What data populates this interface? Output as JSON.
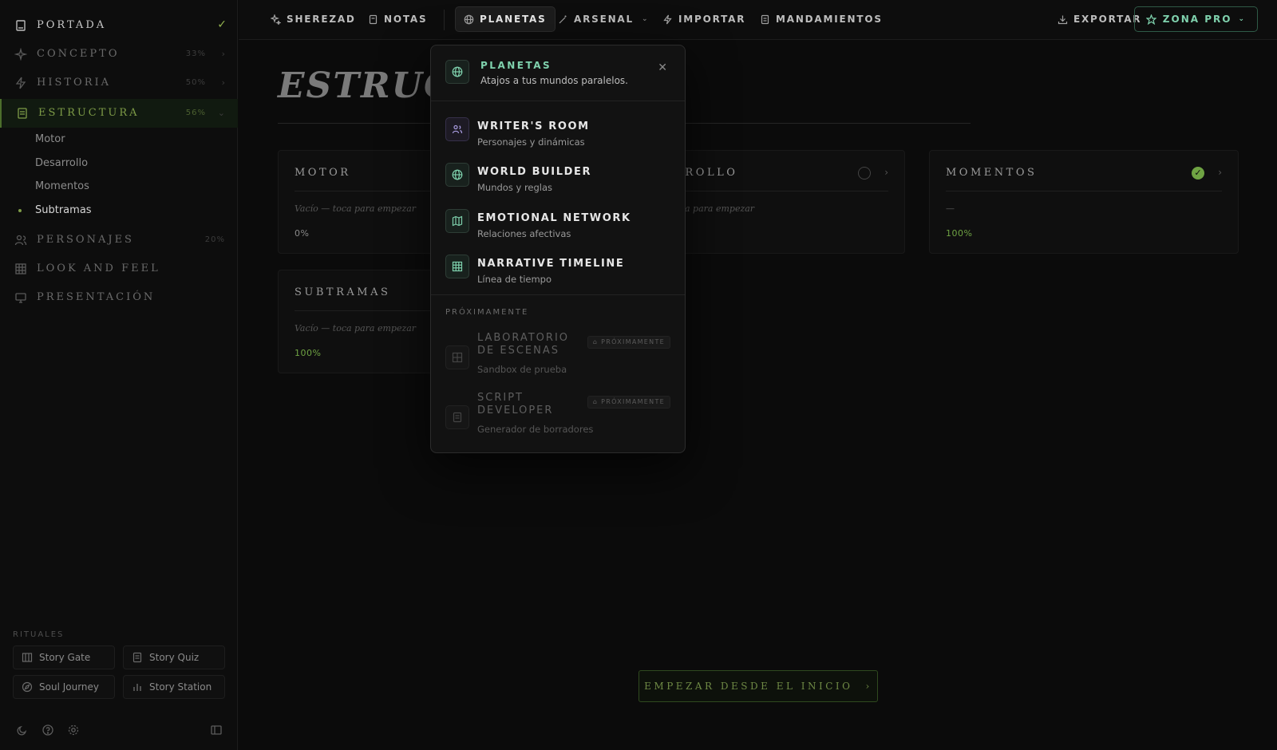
{
  "sidebar": {
    "portada": {
      "label": "PORTADA"
    },
    "items": [
      {
        "label": "CONCEPTO",
        "pct": "33%"
      },
      {
        "label": "HISTORIA",
        "pct": "50%"
      },
      {
        "label": "ESTRUCTURA",
        "pct": "56%"
      }
    ],
    "sub_items": [
      "Motor",
      "Desarrollo",
      "Momentos",
      "Subtramas"
    ],
    "items_after": [
      {
        "label": "PERSONAJES",
        "pct": "20%"
      },
      {
        "label": "LOOK AND FEEL"
      },
      {
        "label": "PRESENTACIÓN"
      }
    ],
    "rituales_title": "RITUALES",
    "rituales": [
      "Story Gate",
      "Story Quiz",
      "Soul Journey",
      "Story Station"
    ]
  },
  "topnav": {
    "items": [
      "SHEREZAD",
      "NOTAS",
      "PLANETAS",
      "ARSENAL",
      "IMPORTAR",
      "MANDAMIENTOS"
    ],
    "export": "EXPORTAR",
    "zona_pro": "ZONA PRO"
  },
  "main": {
    "title": "ESTRUCTURA",
    "cards": [
      {
        "title": "MOTOR",
        "note": "Vacío — toca para empezar",
        "pct": "0%"
      },
      {
        "title": "DESARROLLO",
        "note": "Vacío — toca para empezar",
        "pct": ""
      },
      {
        "title": "MOMENTOS",
        "note": "—",
        "pct": "100%"
      },
      {
        "title": "SUBTRAMAS",
        "note": "Vacío — toca para empezar",
        "pct": "100%"
      }
    ],
    "cta": "EMPEZAR DESDE EL INICIO"
  },
  "planetas_panel": {
    "title": "PLANETAS",
    "subtitle": "Atajos a tus mundos paralelos.",
    "items": [
      {
        "title": "WRITER'S ROOM",
        "subtitle": "Personajes y dinámicas",
        "icon": "users-icon"
      },
      {
        "title": "WORLD BUILDER",
        "subtitle": "Mundos y reglas",
        "icon": "globe-icon"
      },
      {
        "title": "EMOTIONAL NETWORK",
        "subtitle": "Relaciones afectivas",
        "icon": "map-icon"
      },
      {
        "title": "NARRATIVE TIMELINE",
        "subtitle": "Línea de tiempo",
        "icon": "grid-icon"
      }
    ],
    "soon_title": "PRÓXIMAMENTE",
    "soon_items": [
      {
        "title": "LABORATORIO DE ESCENAS",
        "subtitle": "Sandbox de prueba",
        "badge": "PRÓXIMAMENTE"
      },
      {
        "title": "SCRIPT DEVELOPER",
        "subtitle": "Generador de borradores",
        "badge": "PRÓXIMAMENTE"
      }
    ]
  },
  "colors": {
    "accent_green": "#7e9c47",
    "accent_teal": "#7fd1ad",
    "background": "#0b0b0b"
  }
}
